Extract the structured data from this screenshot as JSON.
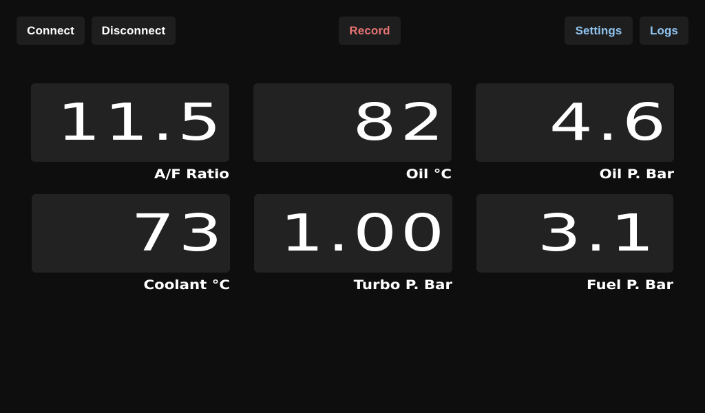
{
  "toolbar": {
    "connect_label": "Connect",
    "disconnect_label": "Disconnect",
    "record_label": "Record",
    "settings_label": "Settings",
    "logs_label": "Logs"
  },
  "colors": {
    "background": "#0e0e0e",
    "button_bg": "#1e1e1e",
    "gauge_bg": "#222222",
    "record_text": "#e57373",
    "nav_text": "#90c4f0"
  },
  "gauges": [
    {
      "value": "11.5",
      "label": "A/F Ratio"
    },
    {
      "value": "82",
      "label": "Oil °C"
    },
    {
      "value": "4.6",
      "label": "Oil P. Bar"
    },
    {
      "value": "73",
      "label": "Coolant °C"
    },
    {
      "value": "1.00",
      "label": "Turbo P. Bar"
    },
    {
      "value": "3.1",
      "label": "Fuel P. Bar"
    }
  ]
}
